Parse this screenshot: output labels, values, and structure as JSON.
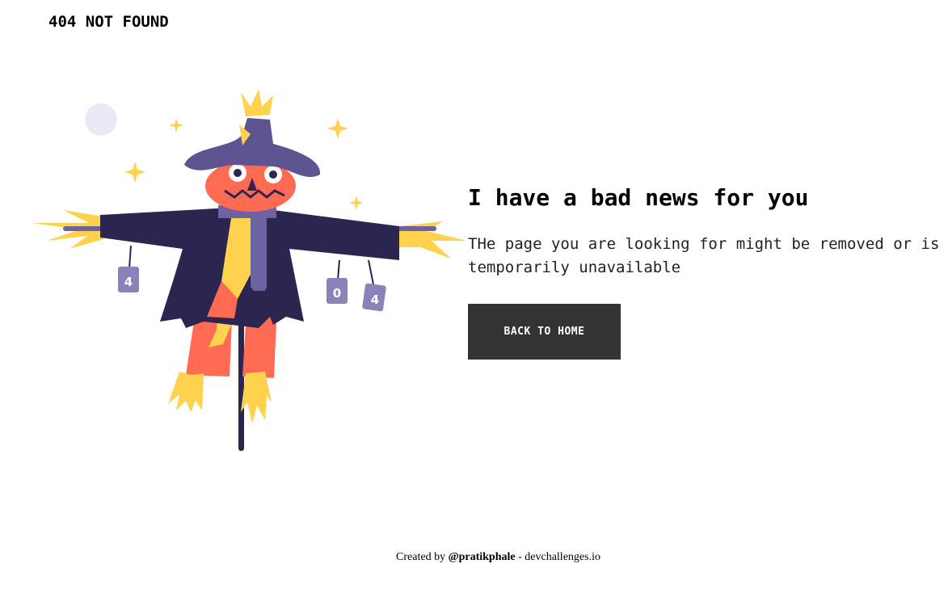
{
  "header": {
    "brand": "404 NOT FOUND"
  },
  "main": {
    "headline": "I have a bad news for you",
    "message": "THe page you are looking for might be removed or is temporarily unavailable",
    "button_label": "BACK TO HOME"
  },
  "illustration": {
    "subject": "scarecrow-illustration",
    "can_labels": [
      "4",
      "0",
      "4"
    ],
    "colors": {
      "hat": "#5E5491",
      "coat": "#2B2550",
      "face": "#FF6B52",
      "straw": "#FFD24E",
      "scarf": "#6C63A0",
      "moon": "#E8EAF6"
    }
  },
  "footer": {
    "prefix": "Created by ",
    "author": "@pratikphale",
    "suffix": " - devchallenges.io"
  }
}
